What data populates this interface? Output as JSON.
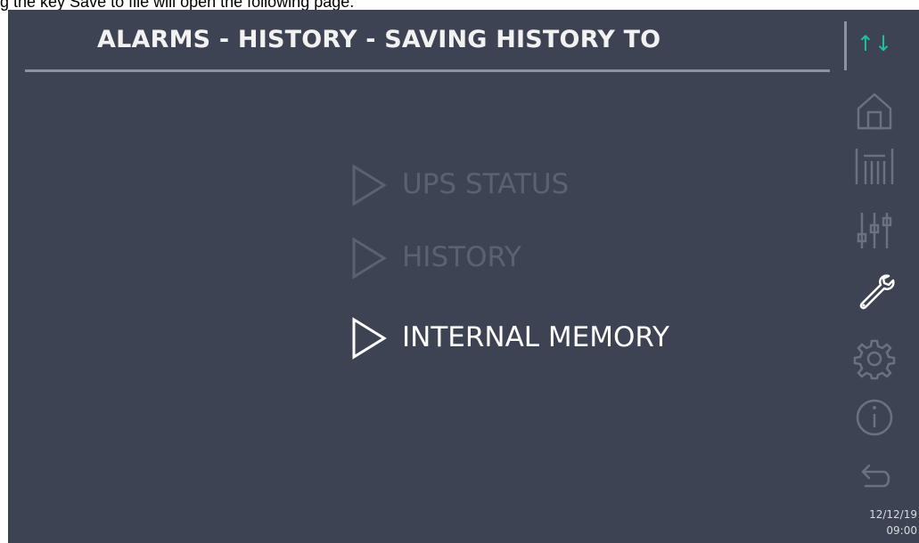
{
  "caption": "g the key Save to file will open the following page.",
  "header": {
    "title": "ALARMS - HISTORY - SAVING HISTORY TO",
    "sort_icon": "up-down-arrows-icon"
  },
  "menu": {
    "items": [
      {
        "label": "UPS STATUS",
        "state": "dimmed"
      },
      {
        "label": "HISTORY",
        "state": "dimmed"
      },
      {
        "label": "INTERNAL MEMORY",
        "state": "active"
      }
    ]
  },
  "sidebar": {
    "icons": [
      "home-icon",
      "measurements-icon",
      "controls-icon",
      "wrench-icon",
      "settings-gear-icon",
      "info-icon",
      "back-arrow-icon"
    ]
  },
  "status": {
    "date": "12/12/19",
    "time": "09:00"
  },
  "colors": {
    "background": "#3d4352",
    "accent": "#1fbfa3",
    "dimmed": "#5a6271",
    "active": "#ffffff"
  }
}
